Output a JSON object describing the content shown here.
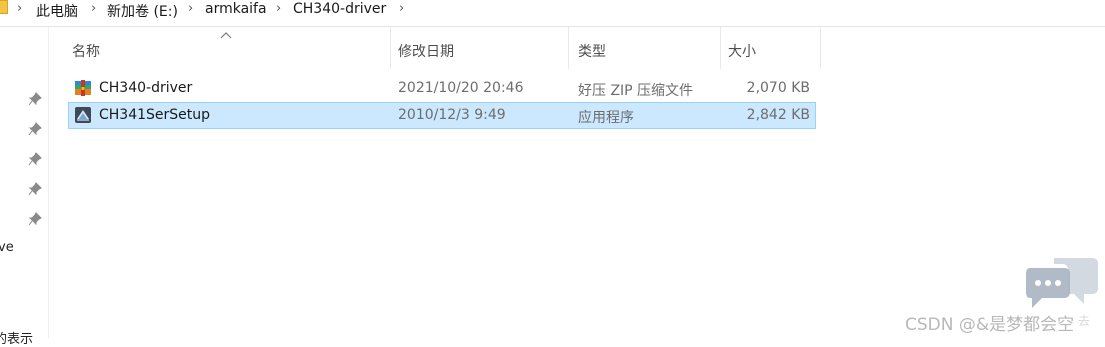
{
  "breadcrumb": {
    "items": [
      "此电脑",
      "新加卷 (E:)",
      "armkaifa",
      "CH340-driver"
    ]
  },
  "nav": {
    "fragment_1": "ve",
    "fragment_2": "的表示"
  },
  "columns": {
    "name": "名称",
    "date": "修改日期",
    "type": "类型",
    "size": "大小"
  },
  "files": [
    {
      "name": "CH340-driver",
      "date": "2021/10/20 20:46",
      "type": "好压 ZIP 压缩文件",
      "size": "2,070 KB",
      "icon": "zip-archive-icon",
      "selected": false
    },
    {
      "name": "CH341SerSetup",
      "date": "2010/12/3 9:49",
      "type": "应用程序",
      "size": "2,842 KB",
      "icon": "installer-app-icon",
      "selected": true
    }
  ],
  "watermark": {
    "text": "CSDN @&是梦都会空",
    "trail": "去"
  },
  "colors": {
    "selection_bg": "#cce8ff",
    "selection_border": "#99d1ff",
    "watermark": "#b8b8b8"
  }
}
